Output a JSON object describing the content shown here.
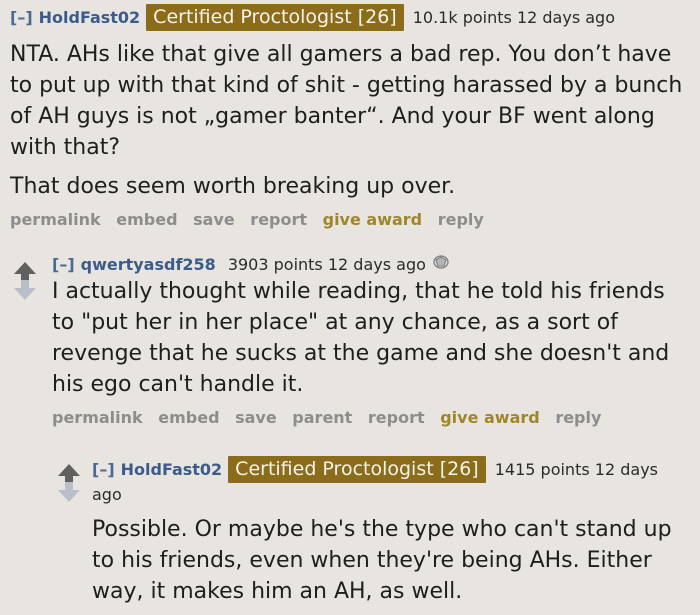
{
  "comments": [
    {
      "collapse": "[–]",
      "author": "HoldFast02",
      "flair": "Certified Proctologist [26]",
      "points": "10.1k points",
      "age": "12 days ago",
      "paragraphs": [
        "NTA. AHs like that give all gamers a bad rep. You don’t have to put up with that kind of shit - getting harassed by a bunch of AH guys is not „gamer banter“. And your BF went along with that?",
        "That does seem worth breaking up over."
      ],
      "buttons": [
        "permalink",
        "embed",
        "save",
        "report",
        "give award",
        "reply"
      ]
    },
    {
      "collapse": "[–]",
      "author": "qwertyasdf258",
      "points": "3903 points",
      "age": "12 days ago",
      "paragraphs": [
        "I actually thought while reading, that he told his friends to \"put her in her place\" at any chance, as a sort of revenge that he sucks at the game and she doesn't and his ego can't handle it."
      ],
      "buttons": [
        "permalink",
        "embed",
        "save",
        "parent",
        "report",
        "give award",
        "reply"
      ]
    },
    {
      "collapse": "[–]",
      "author": "HoldFast02",
      "flair": "Certified Proctologist [26]",
      "points": "1415 points",
      "age": "12 days",
      "age_wrap": "ago",
      "paragraphs": [
        "Possible. Or maybe he's the type who can't stand up to his friends, even when they're being AHs. Either way, it makes him an AH, as well."
      ]
    }
  ],
  "icons": {
    "upvote": "upvote-arrow-icon",
    "downvote": "downvote-arrow-icon",
    "award": "silver-award-icon"
  },
  "colors": {
    "background": "#e8e5e0",
    "username": "#3b5c8a",
    "flair_bg": "#8a6c1a",
    "award_button": "#a0862a",
    "button_gray": "#8d8d8d"
  }
}
